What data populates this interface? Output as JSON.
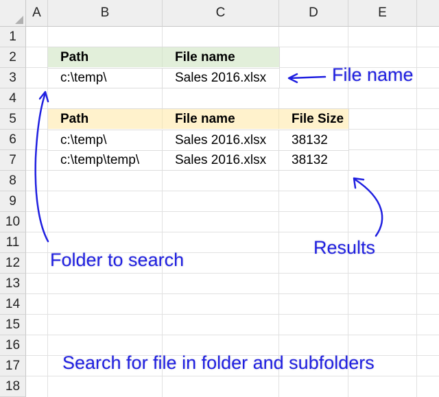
{
  "columns": [
    "A",
    "B",
    "C",
    "D",
    "E"
  ],
  "rows": [
    "1",
    "2",
    "3",
    "4",
    "5",
    "6",
    "7",
    "8",
    "9",
    "10",
    "11",
    "12",
    "13",
    "14",
    "15",
    "16",
    "17",
    "18"
  ],
  "table1": {
    "headers": [
      "Path",
      "File name"
    ],
    "rows": [
      [
        "c:\\temp\\",
        "Sales 2016.xlsx"
      ]
    ],
    "header_color": "#e2efda"
  },
  "table2": {
    "headers": [
      "Path",
      "File name",
      "File Size"
    ],
    "rows": [
      [
        "c:\\temp\\",
        "Sales 2016.xlsx",
        "38132"
      ],
      [
        "c:\\temp\\temp\\",
        "Sales 2016.xlsx",
        "38132"
      ]
    ],
    "header_color": "#fff2cc"
  },
  "annotations": {
    "file_name": "File name",
    "folder_to_search": "Folder to search",
    "results": "Results",
    "title": "Search for file in folder and subfolders",
    "color": "#1f1fe0"
  }
}
